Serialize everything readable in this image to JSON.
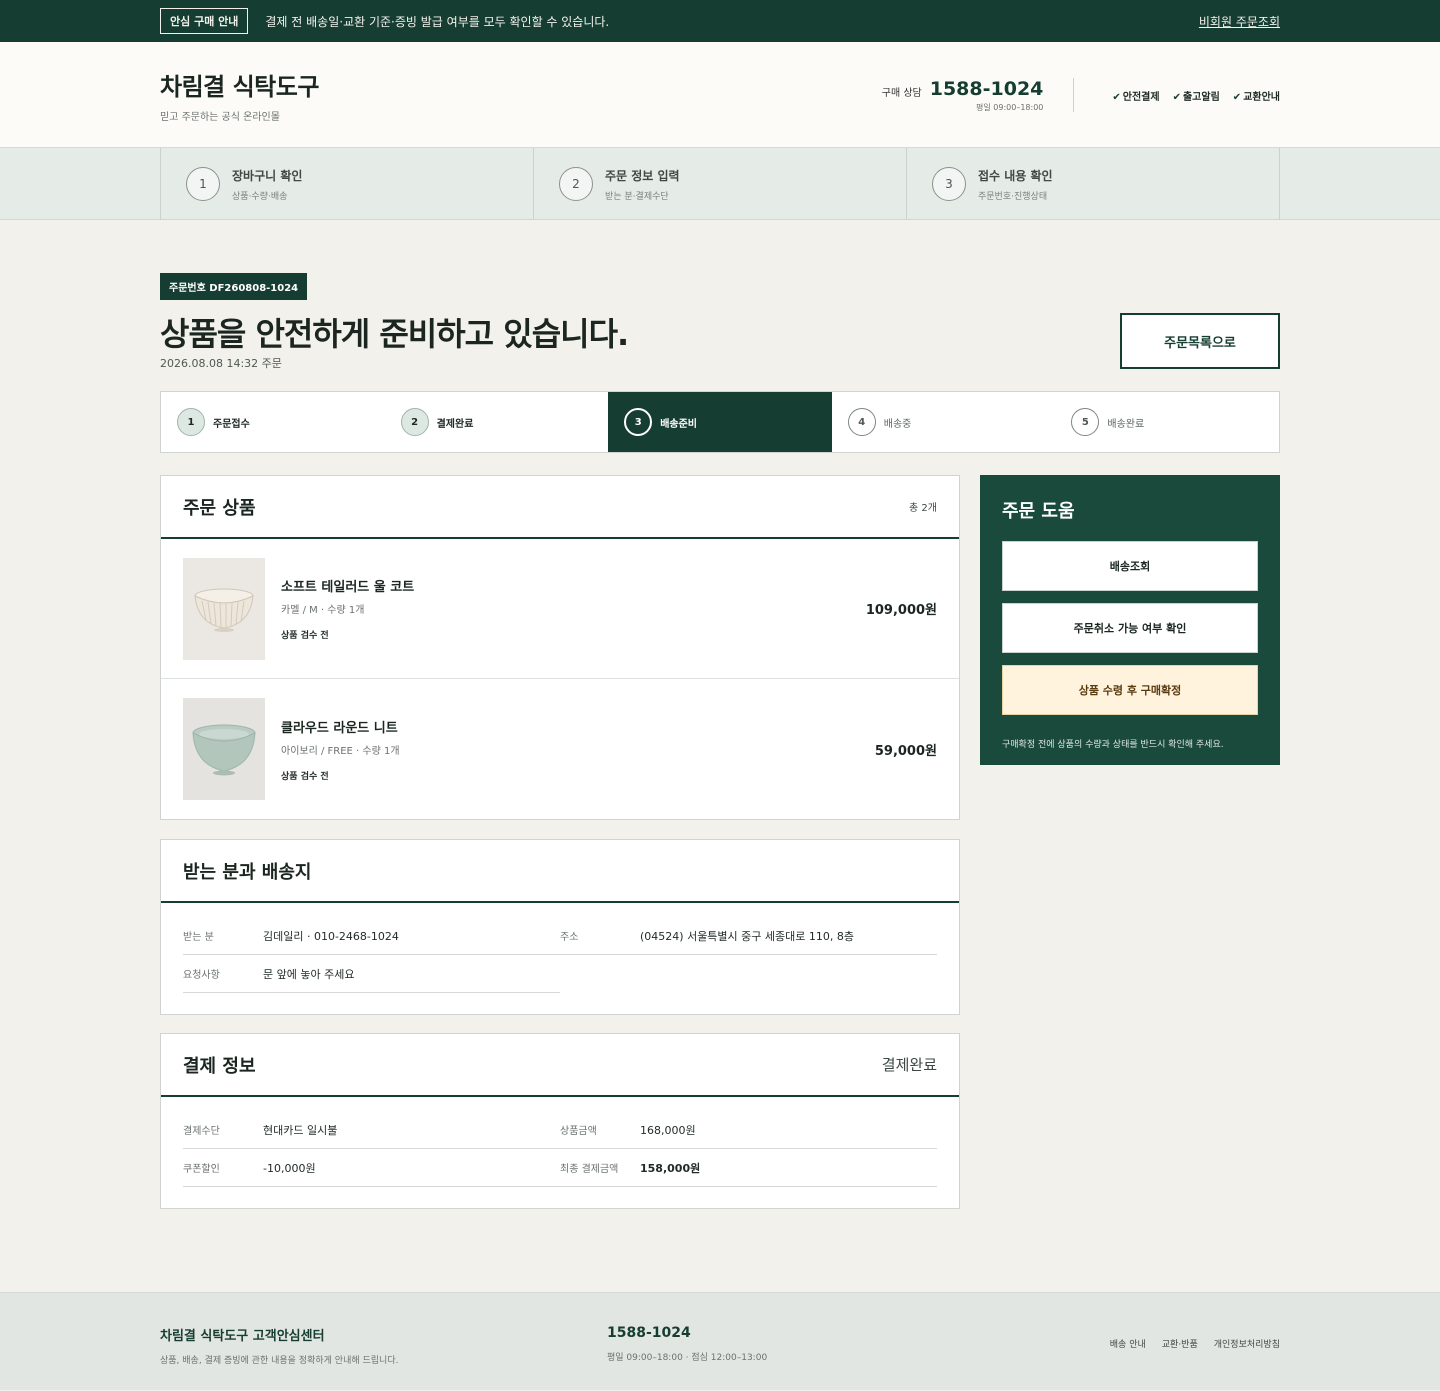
{
  "topbar": {
    "badge": "안심 구매 안내",
    "notice": "결제 전 배송일·교환 기준·증빙 발급 여부를 모두 확인할 수 있습니다.",
    "guest_link": "비회원 주문조회"
  },
  "header": {
    "brand": "차림결 식탁도구",
    "tagline": "믿고 주문하는 공식 온라인몰",
    "contact_label": "구매 상담",
    "phone": "1588-1024",
    "hours": "평일 09:00–18:00",
    "checks": [
      "안전결제",
      "출고알림",
      "교환안내"
    ]
  },
  "checkout_steps": [
    {
      "num": "1",
      "title": "장바구니 확인",
      "sub": "상품·수량·배송"
    },
    {
      "num": "2",
      "title": "주문 정보 입력",
      "sub": "받는 분·결제수단"
    },
    {
      "num": "3",
      "title": "접수 내용 확인",
      "sub": "주문번호·진행상태"
    }
  ],
  "order": {
    "number_badge": "주문번호 DF260808-1024",
    "title": "상품을 안전하게 준비하고 있습니다.",
    "date": "2026.08.08 14:32 주문",
    "list_button": "주문목록으로"
  },
  "progress": [
    {
      "num": "1",
      "label": "주문접수",
      "state": "done"
    },
    {
      "num": "2",
      "label": "결제완료",
      "state": "done"
    },
    {
      "num": "3",
      "label": "배송준비",
      "state": "active"
    },
    {
      "num": "4",
      "label": "배송중",
      "state": "todo"
    },
    {
      "num": "5",
      "label": "배송완료",
      "state": "todo"
    }
  ],
  "products": {
    "title": "주문 상품",
    "count": "총 2개",
    "items": [
      {
        "name": "소프트 테일러드 울 코트",
        "option": "카멜 / M · 수량 1개",
        "status": "상품 검수 전",
        "price": "109,000원",
        "image": "ribbed-cream-bowl"
      },
      {
        "name": "클라우드 라운드 니트",
        "option": "아이보리 / FREE · 수량 1개",
        "status": "상품 검수 전",
        "price": "59,000원",
        "image": "celadon-bowl"
      }
    ]
  },
  "shipping": {
    "title": "받는 분과 배송지",
    "recipient_label": "받는 분",
    "recipient": "김데일리 · 010-2468-1024",
    "address_label": "주소",
    "address": "(04524) 서울특별시 중구 세종대로 110, 8층",
    "request_label": "요청사항",
    "request": "문 앞에 놓아 주세요"
  },
  "payment": {
    "title": "결제 정보",
    "status": "결제완료",
    "method_label": "결제수단",
    "method": "현대카드 일시불",
    "amount_label": "상품금액",
    "amount": "168,000원",
    "coupon_label": "쿠폰할인",
    "coupon": "-10,000원",
    "final_label": "최종 결제금액",
    "final": "158,000원"
  },
  "help": {
    "title": "주문 도움",
    "track": "배송조회",
    "cancel_check": "주문취소 가능 여부 확인",
    "confirm": "상품 수령 후 구매확정",
    "note": "구매확정 전에 상품의 수량과 상태를 반드시 확인해 주세요."
  },
  "footer": {
    "brand": "차림결 식탁도구 고객안심센터",
    "desc": "상품, 배송, 결제 증빙에 관한 내용을 정확하게 안내해 드립니다.",
    "phone": "1588-1024",
    "hours": "평일 09:00–18:00 · 점심 12:00–13:00",
    "links": [
      "배송 안내",
      "교환·반품",
      "개인정보처리방침"
    ]
  },
  "colors": {
    "brand_green": "#163d32",
    "help_panel": "#1a4a3b",
    "page_bg": "#f3f1ec",
    "confirm_bg": "#fff3dd"
  }
}
